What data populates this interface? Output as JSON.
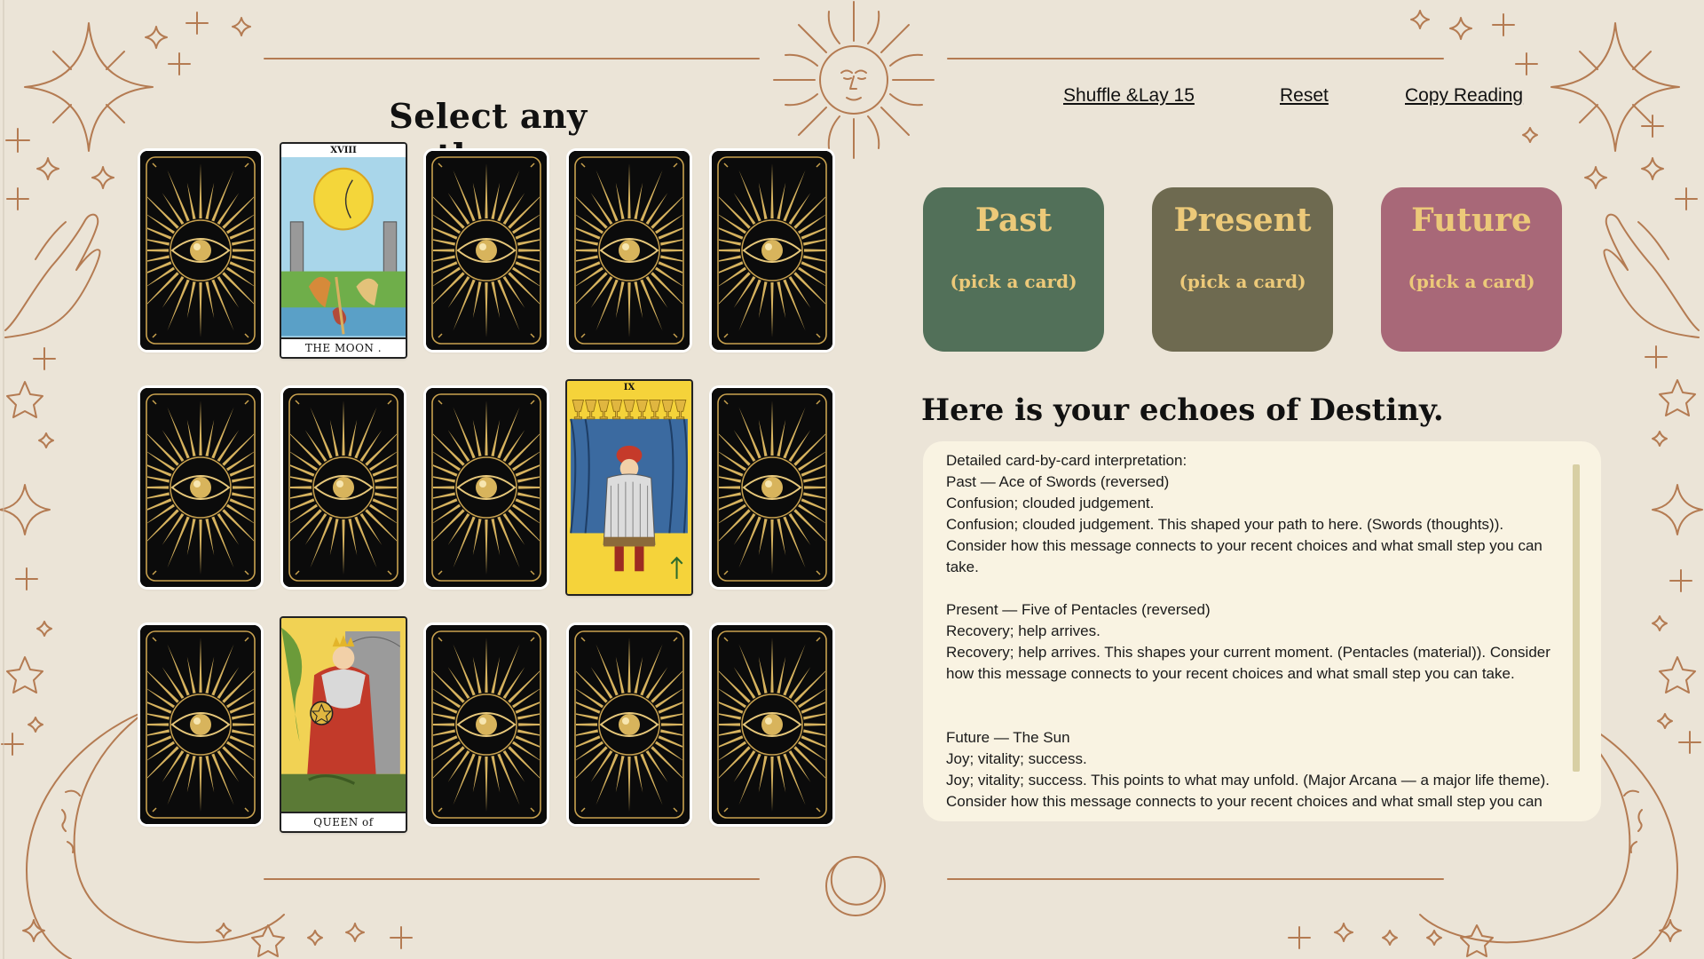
{
  "left": {
    "title": "Select any three",
    "cards": [
      {
        "kind": "back"
      },
      {
        "kind": "face",
        "name": "THE MOON .",
        "numeral": "XVIII",
        "art": "moon"
      },
      {
        "kind": "back"
      },
      {
        "kind": "back"
      },
      {
        "kind": "back"
      },
      {
        "kind": "back"
      },
      {
        "kind": "back"
      },
      {
        "kind": "back"
      },
      {
        "kind": "face",
        "name": "",
        "numeral": "IX",
        "art": "cups"
      },
      {
        "kind": "back"
      },
      {
        "kind": "back"
      },
      {
        "kind": "face",
        "name": "QUEEN of PENTACLES",
        "numeral": "",
        "art": "queen"
      },
      {
        "kind": "back"
      },
      {
        "kind": "back"
      },
      {
        "kind": "back"
      }
    ]
  },
  "toolbar": {
    "shuffle_label": "Shuffle &Lay 15",
    "reset_label": "Reset",
    "copy_label": "Copy Reading"
  },
  "spread": [
    {
      "title": "Past",
      "subtitle": "(pick a card)",
      "color": "#527059"
    },
    {
      "title": "Present",
      "subtitle": "(pick a card)",
      "color": "#6e6a50"
    },
    {
      "title": "Future",
      "subtitle": "(pick a card)",
      "color": "#a86878"
    }
  ],
  "reading": {
    "heading": "Here is your echoes of Destiny.",
    "text": "Detailed card-by-card interpretation:\nPast — Ace of Swords (reversed)\nConfusion; clouded judgement.\nConfusion; clouded judgement. This shaped your path to here. (Swords (thoughts)).\nConsider how this message connects to your recent choices and what small step you can\ntake.\n\nPresent — Five of Pentacles (reversed)\nRecovery; help arrives.\nRecovery; help arrives. This shapes your current moment. (Pentacles (material)). Consider\nhow this message connects to your recent choices and what small step you can take.\n\n\nFuture — The Sun\nJoy; vitality; success.\nJoy; vitality; success. This points to what may unfold. (Major Arcana — a major life theme).\nConsider how this message connects to your recent choices and what small step you can"
  },
  "colors": {
    "background": "#ebe4d7",
    "ornament": "#b47b52",
    "gold": "#ecc979",
    "panel": "#f9f3e2"
  }
}
